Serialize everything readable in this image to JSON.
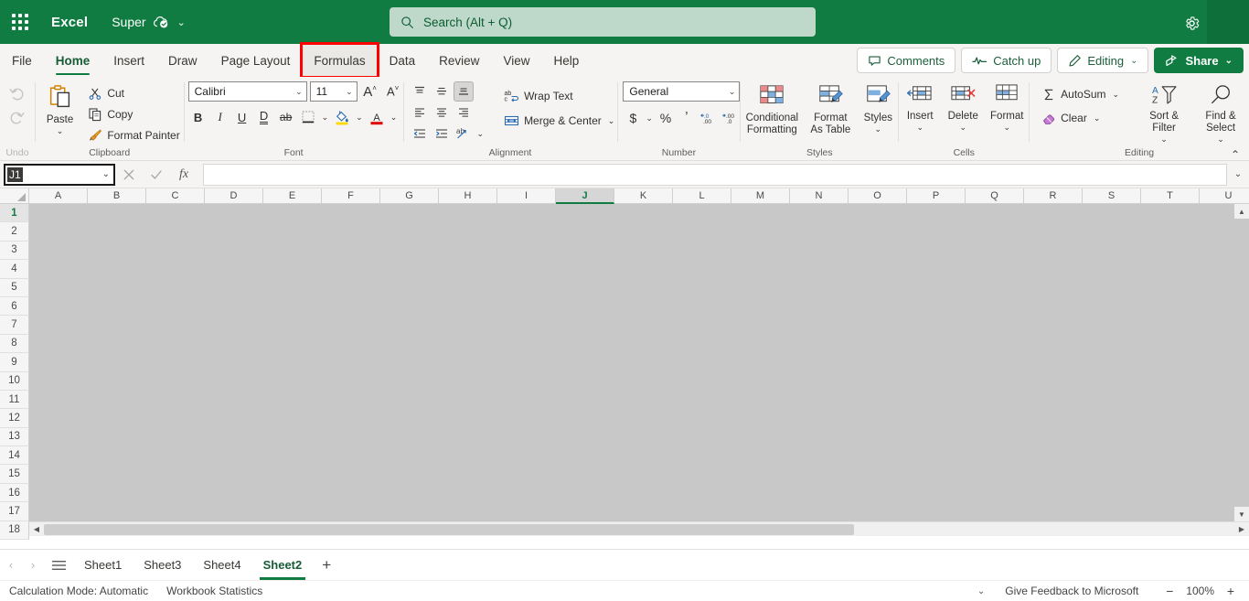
{
  "titlebar": {
    "app_name": "Excel",
    "doc_name": "Super",
    "autosave_icon": "cloud-check-icon",
    "waffle_icon": "app-launcher-icon",
    "chevron_icon": "chevron-down-icon",
    "settings_icon": "gear-icon"
  },
  "search": {
    "placeholder": "Search (Alt + Q)",
    "icon": "search-icon"
  },
  "ribbon_tabs": [
    {
      "label": "File",
      "state": "normal"
    },
    {
      "label": "Home",
      "state": "active"
    },
    {
      "label": "Insert",
      "state": "normal"
    },
    {
      "label": "Draw",
      "state": "normal"
    },
    {
      "label": "Page Layout",
      "state": "normal"
    },
    {
      "label": "Formulas",
      "state": "marked"
    },
    {
      "label": "Data",
      "state": "normal"
    },
    {
      "label": "Review",
      "state": "normal"
    },
    {
      "label": "View",
      "state": "normal"
    },
    {
      "label": "Help",
      "state": "normal"
    }
  ],
  "tab_actions": {
    "comments": "Comments",
    "catch_up": "Catch up",
    "editing": "Editing",
    "share": "Share",
    "chevron": "⌄"
  },
  "ribbon": {
    "undo": {
      "label": "Undo",
      "undo_icon": "undo-arrow-icon",
      "redo_icon": "redo-arrow-icon"
    },
    "clipboard": {
      "label": "Clipboard",
      "paste": "Paste",
      "paste_icon": "clipboard-icon",
      "cut": "Cut",
      "cut_icon": "scissors-icon",
      "copy": "Copy",
      "copy_icon": "copy-pages-icon",
      "format_painter": "Format Painter",
      "format_painter_icon": "paintbrush-icon"
    },
    "font": {
      "label": "Font",
      "font_family": "Calibri",
      "font_size": "11",
      "grow_font": "A",
      "shrink_font": "A",
      "bold": "B",
      "italic": "I",
      "underline": "U",
      "double_underline": "D",
      "strikethrough": "ab",
      "borders_icon": "borders-icon",
      "fill_color_icon": "fill-color-icon",
      "font_color_icon": "font-color-icon",
      "fill_color": "#ffd800",
      "font_color": "#e00000"
    },
    "alignment": {
      "label": "Alignment",
      "align_top_icon": "align-top-icon",
      "align_middle_icon": "align-middle-icon",
      "align_bottom_icon": "align-bottom-icon",
      "align_left_icon": "align-left-icon",
      "align_center_icon": "align-center-icon",
      "align_right_icon": "align-right-icon",
      "decrease_indent_icon": "decrease-indent-icon",
      "increase_indent_icon": "increase-indent-icon",
      "orientation_icon": "text-orientation-icon",
      "wrap_text": "Wrap Text",
      "wrap_text_icon": "wrap-text-icon",
      "merge_center": "Merge & Center",
      "merge_center_icon": "merge-cells-icon"
    },
    "number": {
      "label": "Number",
      "format": "General",
      "currency": "$",
      "percent": "%",
      "comma": "ʼ",
      "increase_decimal_icon": "increase-decimal-icon",
      "decrease_decimal_icon": "decrease-decimal-icon"
    },
    "styles": {
      "label": "Styles",
      "conditional_formatting": "Conditional Formatting",
      "conditional_formatting_icon": "conditional-formatting-icon",
      "format_as_table": "Format As Table",
      "format_as_table_icon": "format-as-table-icon",
      "cell_styles": "Styles",
      "cell_styles_icon": "cell-styles-icon"
    },
    "cells": {
      "label": "Cells",
      "insert": "Insert",
      "insert_icon": "insert-cells-icon",
      "delete": "Delete",
      "delete_icon": "delete-cells-icon",
      "format": "Format",
      "format_icon": "format-cells-icon"
    },
    "editing": {
      "label": "Editing",
      "autosum": "AutoSum",
      "autosum_icon": "sigma-icon",
      "clear": "Clear",
      "clear_icon": "eraser-icon",
      "sort_filter": "Sort & Filter",
      "sort_filter_icon": "sort-filter-icon",
      "find_select": "Find & Select",
      "find_select_icon": "magnifier-icon",
      "collapse_icon": "chevron-up-icon"
    }
  },
  "formula_bar": {
    "name_box_value": "J1",
    "cancel_icon": "close-icon",
    "enter_icon": "checkmark-icon",
    "function_icon": "fx-icon",
    "formula_value": "",
    "expand_icon": "chevron-down-icon"
  },
  "grid": {
    "columns": [
      "A",
      "B",
      "C",
      "D",
      "E",
      "F",
      "G",
      "H",
      "I",
      "J",
      "K",
      "L",
      "M",
      "N",
      "O",
      "P",
      "Q",
      "R",
      "S",
      "T",
      "U"
    ],
    "selected_column": "J",
    "rows": [
      "1",
      "2",
      "3",
      "4",
      "5",
      "6",
      "7",
      "8",
      "9",
      "10",
      "11",
      "12",
      "13",
      "14",
      "15",
      "16",
      "17",
      "18"
    ],
    "selected_row": "1"
  },
  "sheet_bar": {
    "prev_icon": "chevron-left-icon",
    "next_icon": "chevron-right-icon",
    "all_sheets_icon": "hamburger-menu-icon",
    "tabs": [
      {
        "label": "Sheet1",
        "active": false
      },
      {
        "label": "Sheet3",
        "active": false
      },
      {
        "label": "Sheet4",
        "active": false
      },
      {
        "label": "Sheet2",
        "active": true
      }
    ],
    "add_label": "+"
  },
  "status_bar": {
    "calculation_mode": "Calculation Mode: Automatic",
    "workbook_statistics": "Workbook Statistics",
    "chevron": "⌄",
    "feedback": "Give Feedback to Microsoft",
    "zoom_out": "−",
    "zoom_level": "100%",
    "zoom_in": "+"
  },
  "colors": {
    "brand_green": "#107c41",
    "ribbon_bg": "#f5f4f2",
    "highlight_red": "#ff0000",
    "grid_overlay": "#c8c8c8"
  }
}
